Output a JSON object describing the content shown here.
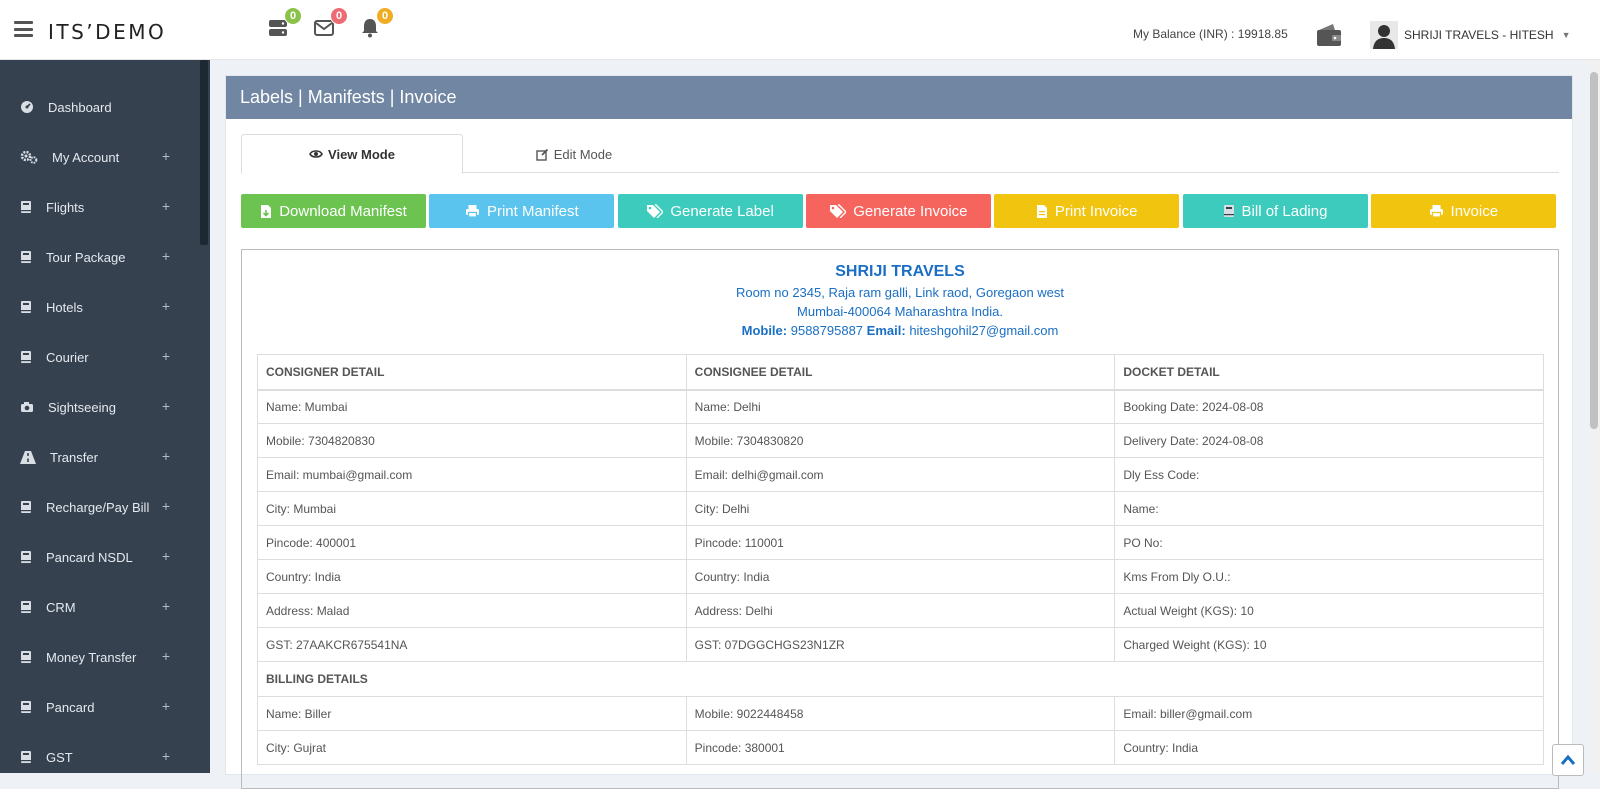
{
  "app": {
    "brand": "ITS’DEMO"
  },
  "header": {
    "notifications": [
      {
        "icon": "server-icon",
        "count": "0",
        "color": "#8bc34a"
      },
      {
        "icon": "envelope-icon",
        "count": "0",
        "color": "#ed6b75"
      },
      {
        "icon": "bell-icon",
        "count": "0",
        "color": "#f0ad24"
      }
    ],
    "balance": "My Balance (INR) : 19918.85",
    "user_name": "SHRIJI TRAVELS - HITESH"
  },
  "sidebar": {
    "items": [
      {
        "label": "Dashboard",
        "icon": "dashboard-icon",
        "expandable": false
      },
      {
        "label": "My Account",
        "icon": "cogs-icon",
        "expandable": true
      },
      {
        "label": "Flights",
        "icon": "book-icon",
        "expandable": true
      },
      {
        "label": "Tour Package",
        "icon": "book-icon",
        "expandable": true
      },
      {
        "label": "Hotels",
        "icon": "book-icon",
        "expandable": true
      },
      {
        "label": "Courier",
        "icon": "book-icon",
        "expandable": true
      },
      {
        "label": "Sightseeing",
        "icon": "camera-icon",
        "expandable": true
      },
      {
        "label": "Transfer",
        "icon": "road-icon",
        "expandable": true
      },
      {
        "label": "Recharge/Pay Bill",
        "icon": "book-icon",
        "expandable": true
      },
      {
        "label": "Pancard NSDL",
        "icon": "book-icon",
        "expandable": true
      },
      {
        "label": "CRM",
        "icon": "book-icon",
        "expandable": true
      },
      {
        "label": "Money Transfer",
        "icon": "book-icon",
        "expandable": true
      },
      {
        "label": "Pancard",
        "icon": "book-icon",
        "expandable": true
      },
      {
        "label": "GST",
        "icon": "book-icon",
        "expandable": true
      }
    ],
    "plus": "+"
  },
  "panel": {
    "title": "Labels | Manifests | Invoice",
    "tabs": [
      {
        "label": "View Mode",
        "icon": "eye-icon"
      },
      {
        "label": "Edit Mode",
        "icon": "edit-icon"
      }
    ],
    "buttons": [
      {
        "label": "Download Manifest",
        "icon": "file-download-icon",
        "color": "#6cc350"
      },
      {
        "label": "Print Manifest",
        "icon": "print-icon",
        "color": "#5bc4ee"
      },
      {
        "label": "Generate Label",
        "icon": "tags-icon",
        "color": "#3dcbbd"
      },
      {
        "label": "Generate Invoice",
        "icon": "tags-icon",
        "color": "#f6645e"
      },
      {
        "label": "Print Invoice",
        "icon": "file-icon",
        "color": "#f1c40f"
      },
      {
        "label": "Bill of Lading",
        "icon": "book-icon",
        "color": "#3dcbbd"
      },
      {
        "label": "Invoice",
        "icon": "print-icon",
        "color": "#f1c40f"
      }
    ]
  },
  "company": {
    "name": "SHRIJI TRAVELS",
    "address1": "Room no 2345, Raja ram galli, Link raod, Goregaon west",
    "address2": "Mumbai-400064 Maharashtra India.",
    "mobile_label": "Mobile:",
    "mobile": "9588795887",
    "email_label": "Email:",
    "email": "hiteshgohil27@gmail.com"
  },
  "details": {
    "headers": [
      "CONSIGNER DETAIL",
      "CONSIGNEE DETAIL",
      "DOCKET DETAIL"
    ],
    "rows": [
      [
        "Name: Mumbai",
        "Name: Delhi",
        "Booking Date: 2024-08-08"
      ],
      [
        "Mobile: 7304820830",
        "Mobile: 7304830820",
        "Delivery Date: 2024-08-08"
      ],
      [
        "Email: mumbai@gmail.com",
        "Email: delhi@gmail.com",
        "Dly Ess Code:"
      ],
      [
        "City: Mumbai",
        "City: Delhi",
        "Name:"
      ],
      [
        "Pincode: 400001",
        "Pincode: 110001",
        "PO No:"
      ],
      [
        "Country: India",
        "Country: India",
        "Kms From Dly O.U.:"
      ],
      [
        "Address: Malad",
        "Address: Delhi",
        "Actual Weight (KGS): 10"
      ],
      [
        "GST: 27AAKCR675541NA",
        "GST: 07DGGCHGS23N1ZR",
        "Charged Weight (KGS): 10"
      ]
    ],
    "billing_header": "BILLING DETAILS",
    "billing_rows": [
      [
        "Name: Biller",
        "Mobile: 9022448458",
        "Email: biller@gmail.com"
      ],
      [
        "City: Gujrat",
        "Pincode: 380001",
        "Country: India"
      ]
    ]
  }
}
